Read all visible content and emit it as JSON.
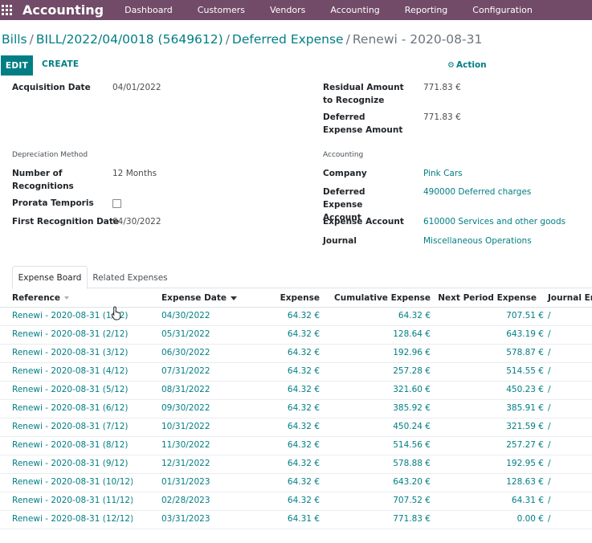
{
  "navbar": {
    "brand": "Accounting",
    "menu": [
      "Dashboard",
      "Customers",
      "Vendors",
      "Accounting",
      "Reporting",
      "Configuration"
    ]
  },
  "breadcrumb": {
    "items": [
      "Bills",
      "BILL/2022/04/0018 (5649612)",
      "Deferred Expense"
    ],
    "current": "Renewi - 2020-08-31",
    "separator": "/"
  },
  "control": {
    "edit_label": "EDIT",
    "create_label": "CREATE",
    "action_label": "Action",
    "action_icon": "gear-icon"
  },
  "form": {
    "acquisition_date_label": "Acquisition Date",
    "acquisition_date": "04/01/2022",
    "residual_label": "Residual Amount to Recognize",
    "residual_value": "771.83 €",
    "deferred_amount_label": "Deferred Expense Amount",
    "deferred_amount_value": "771.83 €",
    "depreciation_method_title": "Depreciation Method",
    "recognitions_label": "Number of Recognitions",
    "recognitions_value": "12 Months",
    "prorata_label": "Prorata Temporis",
    "prorata_checked": false,
    "first_recognition_label": "First Recognition Date",
    "first_recognition_value": "04/30/2022",
    "accounting_title": "Accounting",
    "company_label": "Company",
    "company_value": "Pink Cars",
    "deferred_account_label": "Deferred Expense Account",
    "deferred_account_value": "490000 Deferred charges",
    "expense_account_label": "Expense Account",
    "expense_account_value": "610000 Services and other goods",
    "journal_label": "Journal",
    "journal_value": "Miscellaneous Operations"
  },
  "tabs": [
    "Expense Board",
    "Related Expenses"
  ],
  "table": {
    "headers": [
      "Reference",
      "Expense Date",
      "Expense",
      "Cumulative Expense",
      "Next Period Expense",
      "Journal Ent"
    ],
    "rows": [
      {
        "ref": "Renewi - 2020-08-31 (1/12)",
        "date": "04/30/2022",
        "expense": "64.32 €",
        "cumulative": "64.32 €",
        "next": "707.51 €",
        "je": "/"
      },
      {
        "ref": "Renewi - 2020-08-31 (2/12)",
        "date": "05/31/2022",
        "expense": "64.32 €",
        "cumulative": "128.64 €",
        "next": "643.19 €",
        "je": "/"
      },
      {
        "ref": "Renewi - 2020-08-31 (3/12)",
        "date": "06/30/2022",
        "expense": "64.32 €",
        "cumulative": "192.96 €",
        "next": "578.87 €",
        "je": "/"
      },
      {
        "ref": "Renewi - 2020-08-31 (4/12)",
        "date": "07/31/2022",
        "expense": "64.32 €",
        "cumulative": "257.28 €",
        "next": "514.55 €",
        "je": "/"
      },
      {
        "ref": "Renewi - 2020-08-31 (5/12)",
        "date": "08/31/2022",
        "expense": "64.32 €",
        "cumulative": "321.60 €",
        "next": "450.23 €",
        "je": "/"
      },
      {
        "ref": "Renewi - 2020-08-31 (6/12)",
        "date": "09/30/2022",
        "expense": "64.32 €",
        "cumulative": "385.92 €",
        "next": "385.91 €",
        "je": "/"
      },
      {
        "ref": "Renewi - 2020-08-31 (7/12)",
        "date": "10/31/2022",
        "expense": "64.32 €",
        "cumulative": "450.24 €",
        "next": "321.59 €",
        "je": "/"
      },
      {
        "ref": "Renewi - 2020-08-31 (8/12)",
        "date": "11/30/2022",
        "expense": "64.32 €",
        "cumulative": "514.56 €",
        "next": "257.27 €",
        "je": "/"
      },
      {
        "ref": "Renewi - 2020-08-31 (9/12)",
        "date": "12/31/2022",
        "expense": "64.32 €",
        "cumulative": "578.88 €",
        "next": "192.95 €",
        "je": "/"
      },
      {
        "ref": "Renewi - 2020-08-31 (10/12)",
        "date": "01/31/2023",
        "expense": "64.32 €",
        "cumulative": "643.20 €",
        "next": "128.63 €",
        "je": "/"
      },
      {
        "ref": "Renewi - 2020-08-31 (11/12)",
        "date": "02/28/2023",
        "expense": "64.32 €",
        "cumulative": "707.52 €",
        "next": "64.31 €",
        "je": "/"
      },
      {
        "ref": "Renewi - 2020-08-31 (12/12)",
        "date": "03/31/2023",
        "expense": "64.31 €",
        "cumulative": "771.83 €",
        "next": "0.00 €",
        "je": "/"
      }
    ]
  },
  "colors": {
    "navbar": "#714b67",
    "primary": "#017e84"
  }
}
